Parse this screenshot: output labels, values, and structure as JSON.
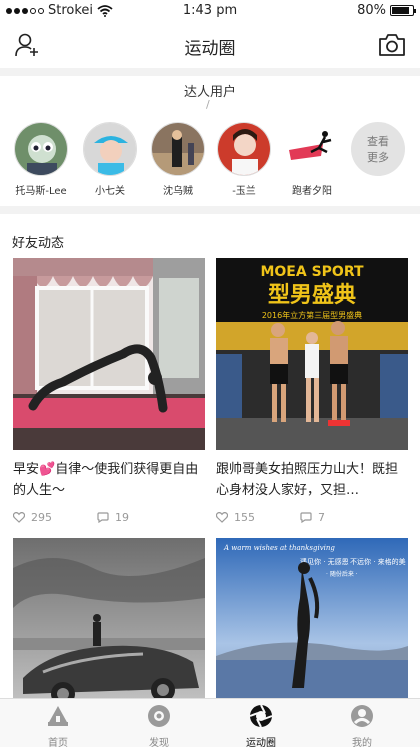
{
  "status_bar": {
    "carrier": "Strokei",
    "time": "1:43 pm",
    "battery": "80%"
  },
  "nav": {
    "title": "运动圈"
  },
  "experts": {
    "heading": "达人用户",
    "divider": "/",
    "users": [
      {
        "name": "托马斯-Lee"
      },
      {
        "name": "小七关"
      },
      {
        "name": "沈乌贼"
      },
      {
        "name": "-玉兰"
      },
      {
        "name": "跑者夕阳"
      }
    ],
    "more_line1": "查看",
    "more_line2": "更多"
  },
  "friends": {
    "heading": "好友动态",
    "posts": [
      {
        "caption_before": "早安",
        "caption_after": "自律～使我们获得更自由的人生～",
        "likes": "295",
        "comments": "19"
      },
      {
        "caption": "跟帅哥美女拍照压力山大！既担心身材没人家好，又担…",
        "likes": "155",
        "comments": "7",
        "poster_brand": "MOEA SPORT",
        "poster_title": "型男盛典",
        "poster_sub": "2016年立方第三届型男盛典"
      },
      {
        "caption": ""
      },
      {
        "caption": "",
        "overlay_script": "A warm wishes at thanksgiving",
        "overlay_1": "遇见你 · 无感恩",
        "overlay_2": "不远你 · 来格的美",
        "overlay_3": "· 随份后来 ·"
      }
    ]
  },
  "tabs": [
    {
      "label": "首页"
    },
    {
      "label": "发现"
    },
    {
      "label": "运动圈"
    },
    {
      "label": "我的"
    }
  ],
  "colors": {
    "accent_pink": "#e8477a",
    "icon_gray": "#9a9a9a",
    "tab_active": "#111111"
  }
}
